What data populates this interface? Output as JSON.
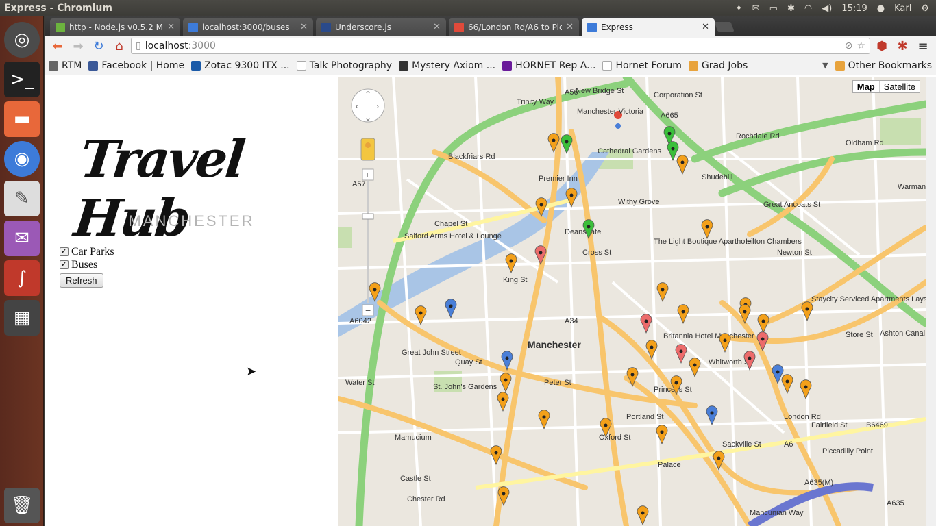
{
  "window_title": "Express - Chromium",
  "indicators": {
    "time": "15:19",
    "user": "Karl"
  },
  "tabs": [
    {
      "label": "http - Node.js v0.5.2 Manual",
      "color": "#6cb33e"
    },
    {
      "label": "localhost:3000/buses",
      "color": "#3d7bd9"
    },
    {
      "label": "Underscore.js",
      "color": "#2a4a8a"
    },
    {
      "label": "66/London Rd/A6 to Piccadilly",
      "color": "#e04a3a"
    },
    {
      "label": "Express",
      "color": "#3d7bd9"
    }
  ],
  "address": {
    "host": "localhost",
    "port": ":3000"
  },
  "bookmarks": [
    {
      "label": "RTM",
      "color": "#666"
    },
    {
      "label": "Facebook | Home",
      "color": "#3b5998"
    },
    {
      "label": "Zotac 9300 ITX ...",
      "color": "#1a5aa8"
    },
    {
      "label": "Talk Photography",
      "color": "#ccc"
    },
    {
      "label": "Mystery Axiom ...",
      "color": "#333"
    },
    {
      "label": "HORNET Rep A...",
      "color": "#6a1b9a"
    },
    {
      "label": "Hornet Forum",
      "color": "#ccc"
    },
    {
      "label": "Grad Jobs",
      "color": "#e8a33c"
    }
  ],
  "other_bookmarks": "Other Bookmarks",
  "page": {
    "logo": "Travel Hub",
    "city": "MANCHESTER",
    "car_parks_label": "Car Parks",
    "car_parks_checked": true,
    "buses_label": "Buses",
    "buses_checked": true,
    "refresh_label": "Refresh"
  },
  "map": {
    "map_label": "Map",
    "satellite_label": "Satellite",
    "selected_type": "Map",
    "labels": [
      "Manchester",
      "Manchester Victoria",
      "Cathedral Gardens",
      "Premier Inn",
      "Salford Arms Hotel & Lounge",
      "Withy Grove",
      "The Light Boutique Aparthotel",
      "Britannia Hotel Manchester",
      "Hilton Chambers",
      "Staycity Serviced Apartments Laystall St",
      "Great John Street",
      "St. John's Gardens",
      "Mamucium",
      "Palace",
      "Piccadilly Point",
      "Ashton Canal",
      "Warman",
      "Trinity Way",
      "Chapel St",
      "Deansgate",
      "Quay St",
      "Peter St",
      "Portland St",
      "Oxford St",
      "London Rd",
      "Fairfield St",
      "Rochdale Rd",
      "Great Ancoats St",
      "Oldham Rd",
      "Mancunian Way",
      "New Bridge St",
      "Blackfriars Rd",
      "Corporation St",
      "Shudehill",
      "King St",
      "Cross St",
      "Newton St",
      "Store St",
      "Princess St",
      "Sackville St",
      "Whitworth St",
      "Chester Rd",
      "Water St",
      "Castle St",
      "A6042",
      "A665",
      "A34",
      "A56",
      "A6",
      "B6469",
      "A635(M)",
      "A635",
      "A57"
    ],
    "colors": {
      "water": "#a9c5e6",
      "primary_road": "#f8c56c",
      "trunk_road": "#8cd17c",
      "minor_road": "#ffffff",
      "park": "#c8dfb0",
      "pin_orange": "#f3a01a",
      "pin_green": "#3bbf3b",
      "pin_red": "#ec6b6b",
      "pin_blue": "#4a7fd8"
    }
  }
}
